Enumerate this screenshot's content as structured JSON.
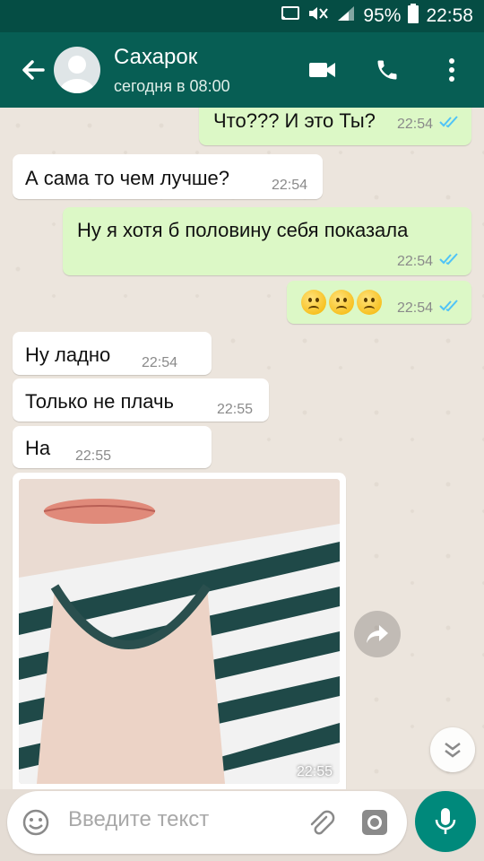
{
  "statusbar": {
    "battery": "95%",
    "time": "22:58"
  },
  "header": {
    "name": "Сахарок",
    "status": "сегодня в 08:00"
  },
  "messages": [
    {
      "text": "Что??? И это Ты?",
      "time": "22:54",
      "dir": "out"
    },
    {
      "text": "А сама то чем лучше?",
      "time": "22:54",
      "dir": "in"
    },
    {
      "text": "Ну я хотя б половину себя показала",
      "time": "22:54",
      "dir": "out"
    },
    {
      "text": "",
      "emoji": [
        "confused-face",
        "confused-face",
        "confused-face"
      ],
      "time": "22:54",
      "dir": "out"
    },
    {
      "text": "Ну ладно",
      "time": "22:54",
      "dir": "in"
    },
    {
      "text": "Только не плачь",
      "time": "22:55",
      "dir": "in"
    },
    {
      "text": "На",
      "time": "22:55",
      "dir": "in"
    },
    {
      "type": "photo",
      "time": "22:55",
      "dir": "in"
    }
  ],
  "input": {
    "placeholder": "Введите текст"
  },
  "colors": {
    "header": "#075e54",
    "statusbar": "#054d44",
    "outgoing": "#dcf8c6",
    "incoming": "#ffffff",
    "read_ticks": "#4fc3f7",
    "mic": "#00897b"
  }
}
